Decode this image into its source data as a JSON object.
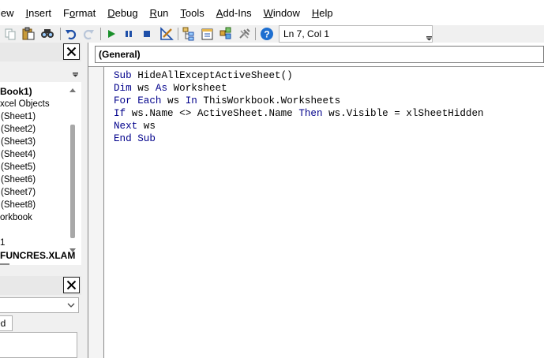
{
  "menu": {
    "items": [
      {
        "pre": "",
        "mn": "",
        "post": "iew"
      },
      {
        "pre": "",
        "mn": "I",
        "post": "nsert"
      },
      {
        "pre": "F",
        "mn": "o",
        "post": "rmat"
      },
      {
        "pre": "",
        "mn": "D",
        "post": "ebug"
      },
      {
        "pre": "",
        "mn": "R",
        "post": "un"
      },
      {
        "pre": "",
        "mn": "T",
        "post": "ools"
      },
      {
        "pre": "",
        "mn": "A",
        "post": "dd-Ins"
      },
      {
        "pre": "",
        "mn": "W",
        "post": "indow"
      },
      {
        "pre": "",
        "mn": "H",
        "post": "elp"
      }
    ]
  },
  "toolbar": {
    "position": "Ln 7, Col 1",
    "icons": [
      "copy-icon",
      "paste-icon",
      "find-icon",
      "undo-icon",
      "redo-icon",
      "run-icon",
      "break-icon",
      "reset-icon",
      "design-mode-icon",
      "project-explorer-icon",
      "properties-icon",
      "object-browser-icon",
      "toolbox-icon",
      "help-icon"
    ]
  },
  "project": {
    "tree": [
      {
        "text": "Book1)",
        "bold": true
      },
      {
        "text": "xcel Objects",
        "bold": false
      },
      {
        "text": " (Sheet1)",
        "bold": false
      },
      {
        "text": " (Sheet2)",
        "bold": false
      },
      {
        "text": " (Sheet3)",
        "bold": false
      },
      {
        "text": " (Sheet4)",
        "bold": false
      },
      {
        "text": " (Sheet5)",
        "bold": false
      },
      {
        "text": " (Sheet6)",
        "bold": false
      },
      {
        "text": " (Sheet7)",
        "bold": false
      },
      {
        "text": " (Sheet8)",
        "bold": false
      },
      {
        "text": "orkbook",
        "bold": false
      },
      {
        "text": "",
        "bold": false
      },
      {
        "text": "1",
        "bold": false
      },
      {
        "text": "FUNCRES.XLAM",
        "bold": true
      }
    ]
  },
  "properties": {
    "tab": "ed"
  },
  "code": {
    "combo": "(General)",
    "lines": [
      [
        {
          "k": true,
          "t": "Sub "
        },
        {
          "k": false,
          "t": "HideAllExceptActiveSheet()"
        }
      ],
      [
        {
          "k": true,
          "t": "Dim "
        },
        {
          "k": false,
          "t": "ws "
        },
        {
          "k": true,
          "t": "As "
        },
        {
          "k": false,
          "t": "Worksheet"
        }
      ],
      [
        {
          "k": true,
          "t": "For Each "
        },
        {
          "k": false,
          "t": "ws "
        },
        {
          "k": true,
          "t": "In "
        },
        {
          "k": false,
          "t": "ThisWorkbook.Worksheets"
        }
      ],
      [
        {
          "k": true,
          "t": "If "
        },
        {
          "k": false,
          "t": "ws.Name <> ActiveSheet.Name "
        },
        {
          "k": true,
          "t": "Then "
        },
        {
          "k": false,
          "t": "ws.Visible = xlSheetHidden"
        }
      ],
      [
        {
          "k": true,
          "t": "Next "
        },
        {
          "k": false,
          "t": "ws"
        }
      ],
      [
        {
          "k": true,
          "t": "End Sub"
        }
      ]
    ]
  }
}
